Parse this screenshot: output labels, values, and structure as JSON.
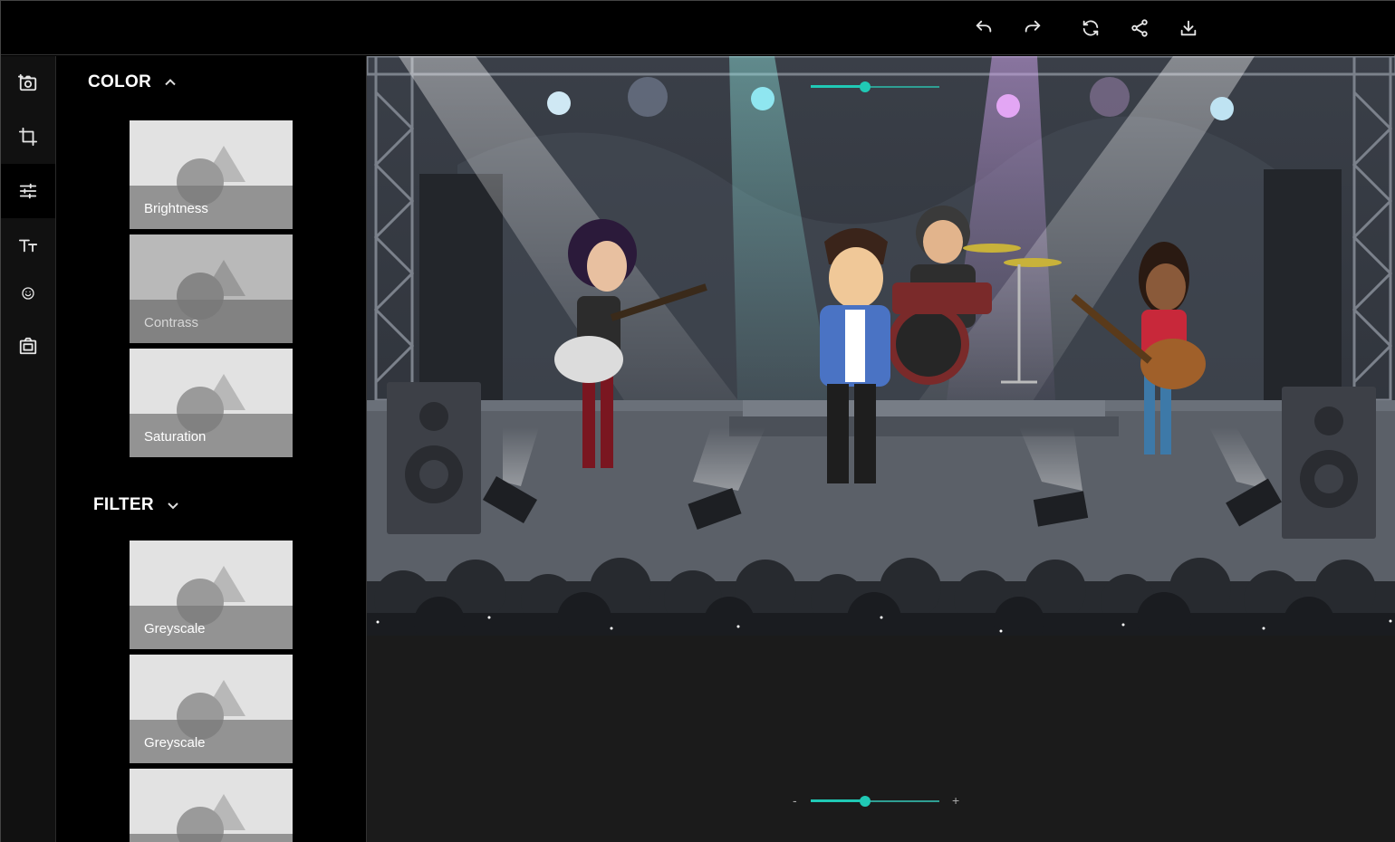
{
  "toolbar": {
    "undo_icon": "undo-icon",
    "redo_icon": "redo-icon",
    "reset_icon": "refresh-icon",
    "share_icon": "share-icon",
    "download_icon": "download-icon"
  },
  "rail": {
    "items": [
      {
        "icon": "add-photo-icon",
        "active": false
      },
      {
        "icon": "crop-icon",
        "active": false
      },
      {
        "icon": "sliders-icon",
        "active": true
      },
      {
        "icon": "text-icon",
        "active": false
      },
      {
        "icon": "emoji-icon",
        "active": false
      },
      {
        "icon": "frame-icon",
        "active": false
      }
    ]
  },
  "panel": {
    "color_title": "COLOR",
    "color_items": [
      "Brightness",
      "Contrass",
      "Saturation"
    ],
    "filter_title": "FILTER",
    "filter_items": [
      "Greyscale",
      "Greyscale"
    ]
  },
  "sliders": {
    "top_level": 0.42,
    "zoom_level": 0.42,
    "zoom_minus": "-",
    "zoom_plus": "+"
  },
  "colors": {
    "accent": "#20c9b5",
    "background": "#000000",
    "canvas_bg": "#1b1b1b"
  }
}
